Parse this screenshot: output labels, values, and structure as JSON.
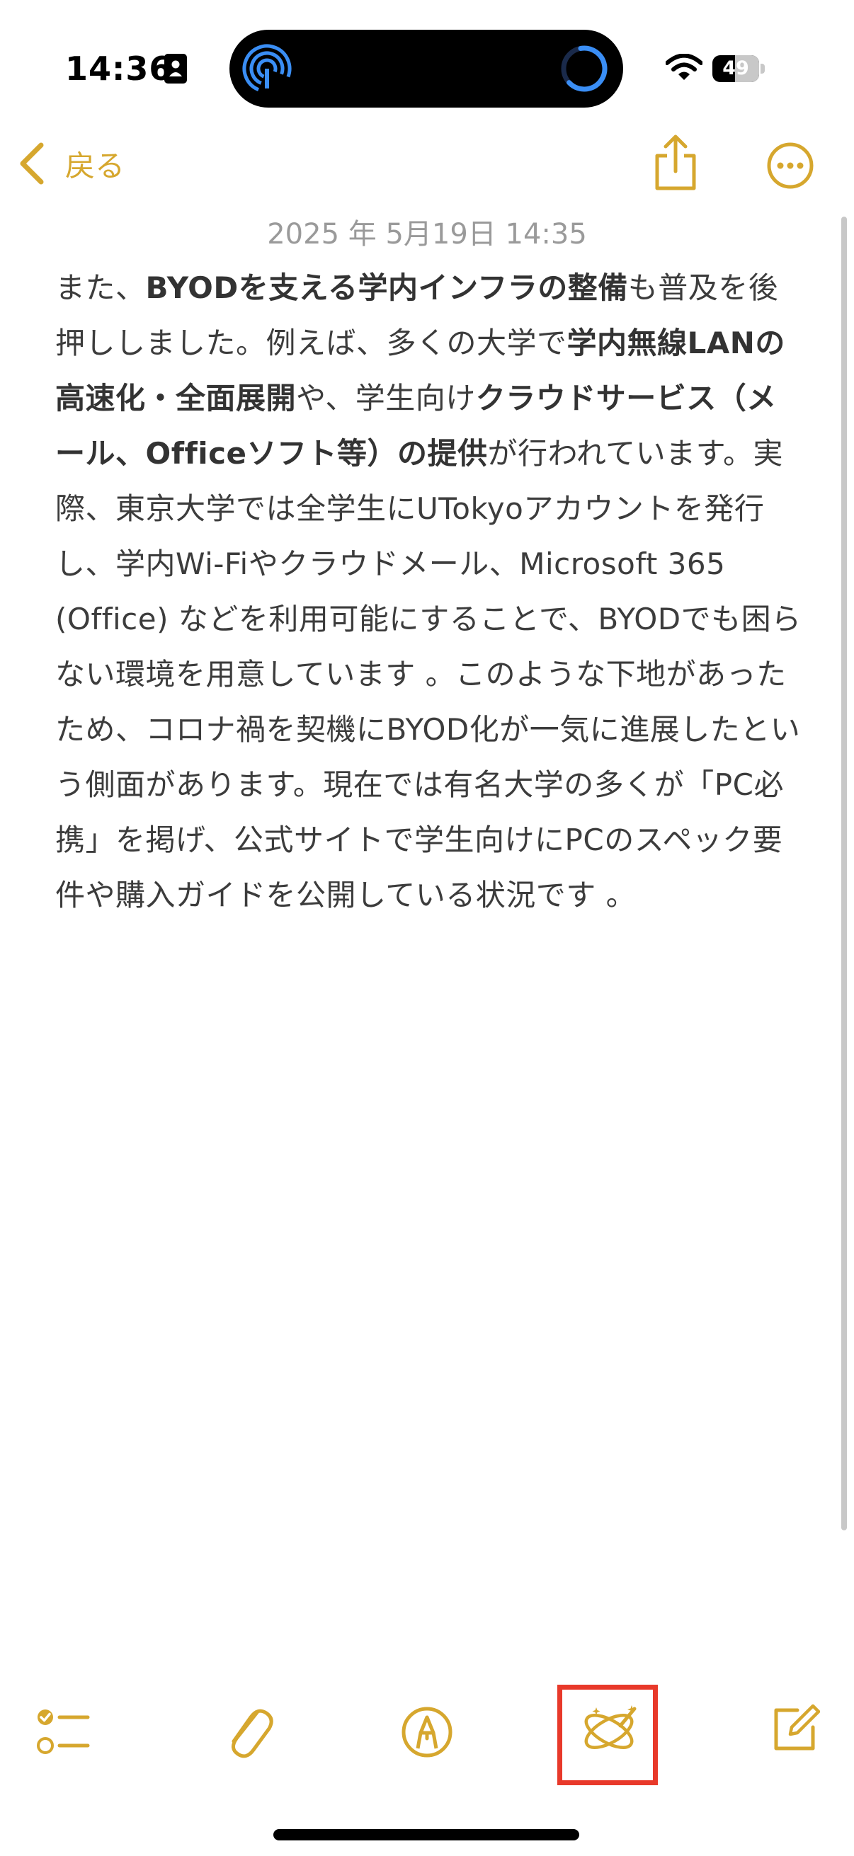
{
  "status_bar": {
    "time": "14:36",
    "battery_level": "49",
    "battery_fraction": 0.49
  },
  "nav": {
    "back_label": "戻る"
  },
  "note": {
    "date": "2025 年 5月19日 14:35",
    "segments": [
      {
        "text": "また、",
        "bold": false
      },
      {
        "text": "BYODを支える学内インフラの整備",
        "bold": true
      },
      {
        "text": "も普及を後押ししました。例えば、多くの大学で",
        "bold": false
      },
      {
        "text": "学内無線LANの高速化・全面展開",
        "bold": true
      },
      {
        "text": "や、学生向け",
        "bold": false
      },
      {
        "text": "クラウドサービス（メール、Officeソフト等）の提供",
        "bold": true
      },
      {
        "text": "が行われています。実際、東京大学では全学生にUTokyoアカウントを発行し、学内Wi-Fiやクラウドメール、Microsoft 365 (Office) などを利用可能にすることで、BYODでも困らない環境を用意しています 。このような下地があったため、コロナ禍を契機にBYOD化が一気に進展したという側面があります。現在では有名大学の多くが「PC必携」を掲げ、公式サイトで学生向けにPCのスペック要件や購入ガイドを公開している状況です 。",
        "bold": false
      }
    ]
  },
  "colors": {
    "accent": "#d6a72e",
    "highlight": "#e8392a",
    "airdrop": "#3a8ef5",
    "text": "#3c3c3c",
    "date_text": "#9a9a9a"
  },
  "toolbar": {
    "icons": [
      "checklist-icon",
      "paperclip-icon",
      "markup-pen-icon",
      "writing-tools-icon",
      "compose-icon"
    ]
  }
}
